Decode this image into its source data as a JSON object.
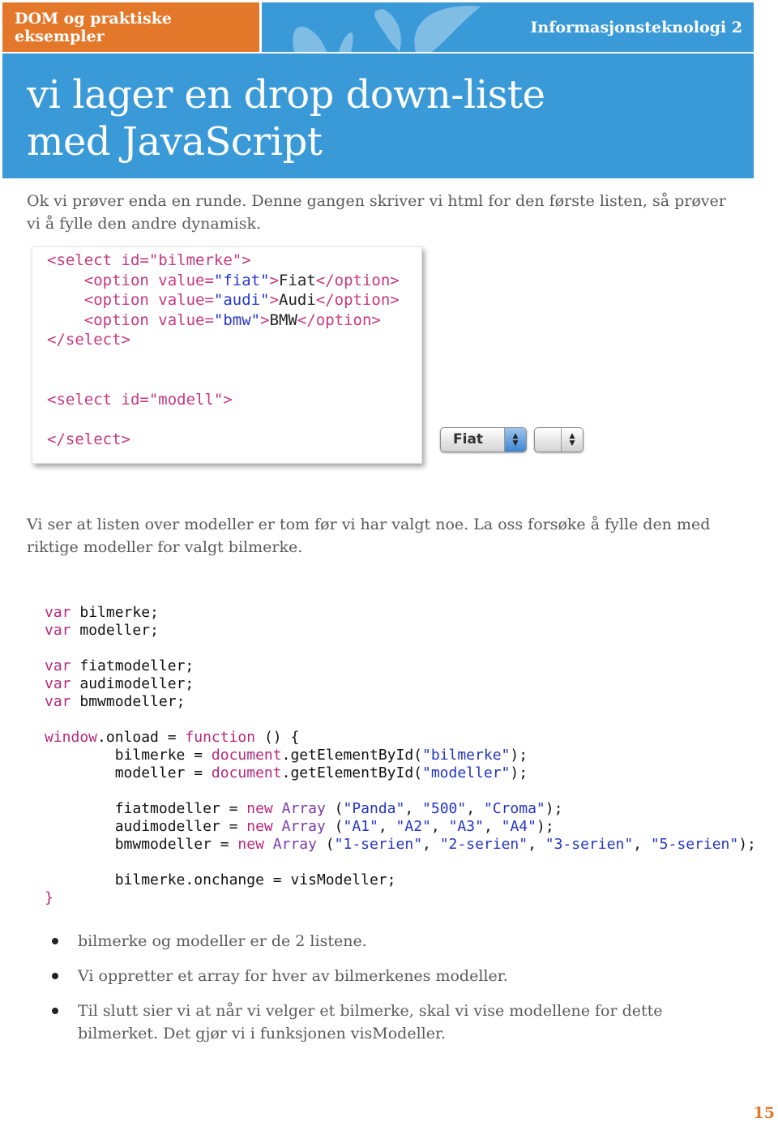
{
  "header": {
    "left_title": "DOM og praktiske eksempler",
    "right_title": "Informasjonsteknologi 2",
    "left_color": "#e4782a",
    "right_color": "#3a9ad8"
  },
  "title": {
    "line1": "vi lager en drop down-liste",
    "line2": "med JavaScript"
  },
  "intro": "Ok vi prøver enda en runde. Denne gangen skriver vi html for den første listen, så prøver vi å fylle den andre dynamisk.",
  "html_code": {
    "select1_open": "<select id=\"bilmerke\">",
    "options": [
      {
        "value": "fiat",
        "label": "Fiat"
      },
      {
        "value": "audi",
        "label": "Audi"
      },
      {
        "value": "bmw",
        "label": "BMW"
      }
    ],
    "select_close": "</select>",
    "select2_open": "<select id=\"modell\">"
  },
  "dropdowns": {
    "bilmerke_selected": "Fiat",
    "modell_selected": ""
  },
  "para2": "Vi ser at listen over modeller er tom før vi har valgt noe. La oss forsøke å fylle den med riktige modeller for valgt bilmerke.",
  "js_code": {
    "var1": "bilmerke;",
    "var2": "modeller;",
    "var3": "fiatmodeller;",
    "var4": "audimodeller;",
    "var5": "bmwmodeller;",
    "fiat": [
      "\"Panda\"",
      "\"500\"",
      "\"Croma\""
    ],
    "audi": [
      "\"A1\"",
      "\"A2\"",
      "\"A3\"",
      "\"A4\""
    ],
    "bmw": [
      "\"1-serien\"",
      "\"2-serien\"",
      "\"3-serien\"",
      "\"5-serien\""
    ],
    "id_bilmerke": "\"bilmerke\"",
    "id_modeller": "\"modeller\"",
    "onchange_line": "bilmerke.onchange = visModeller;"
  },
  "bullets": [
    "bilmerke og modeller er de 2 listene.",
    "Vi oppretter et array for hver av bilmerkenes modeller.",
    "Til slutt sier vi at når vi velger et bilmerke, skal vi vise modellene for dette bilmerket. Det gjør vi i funksjonen visModeller."
  ],
  "page_number": "15"
}
